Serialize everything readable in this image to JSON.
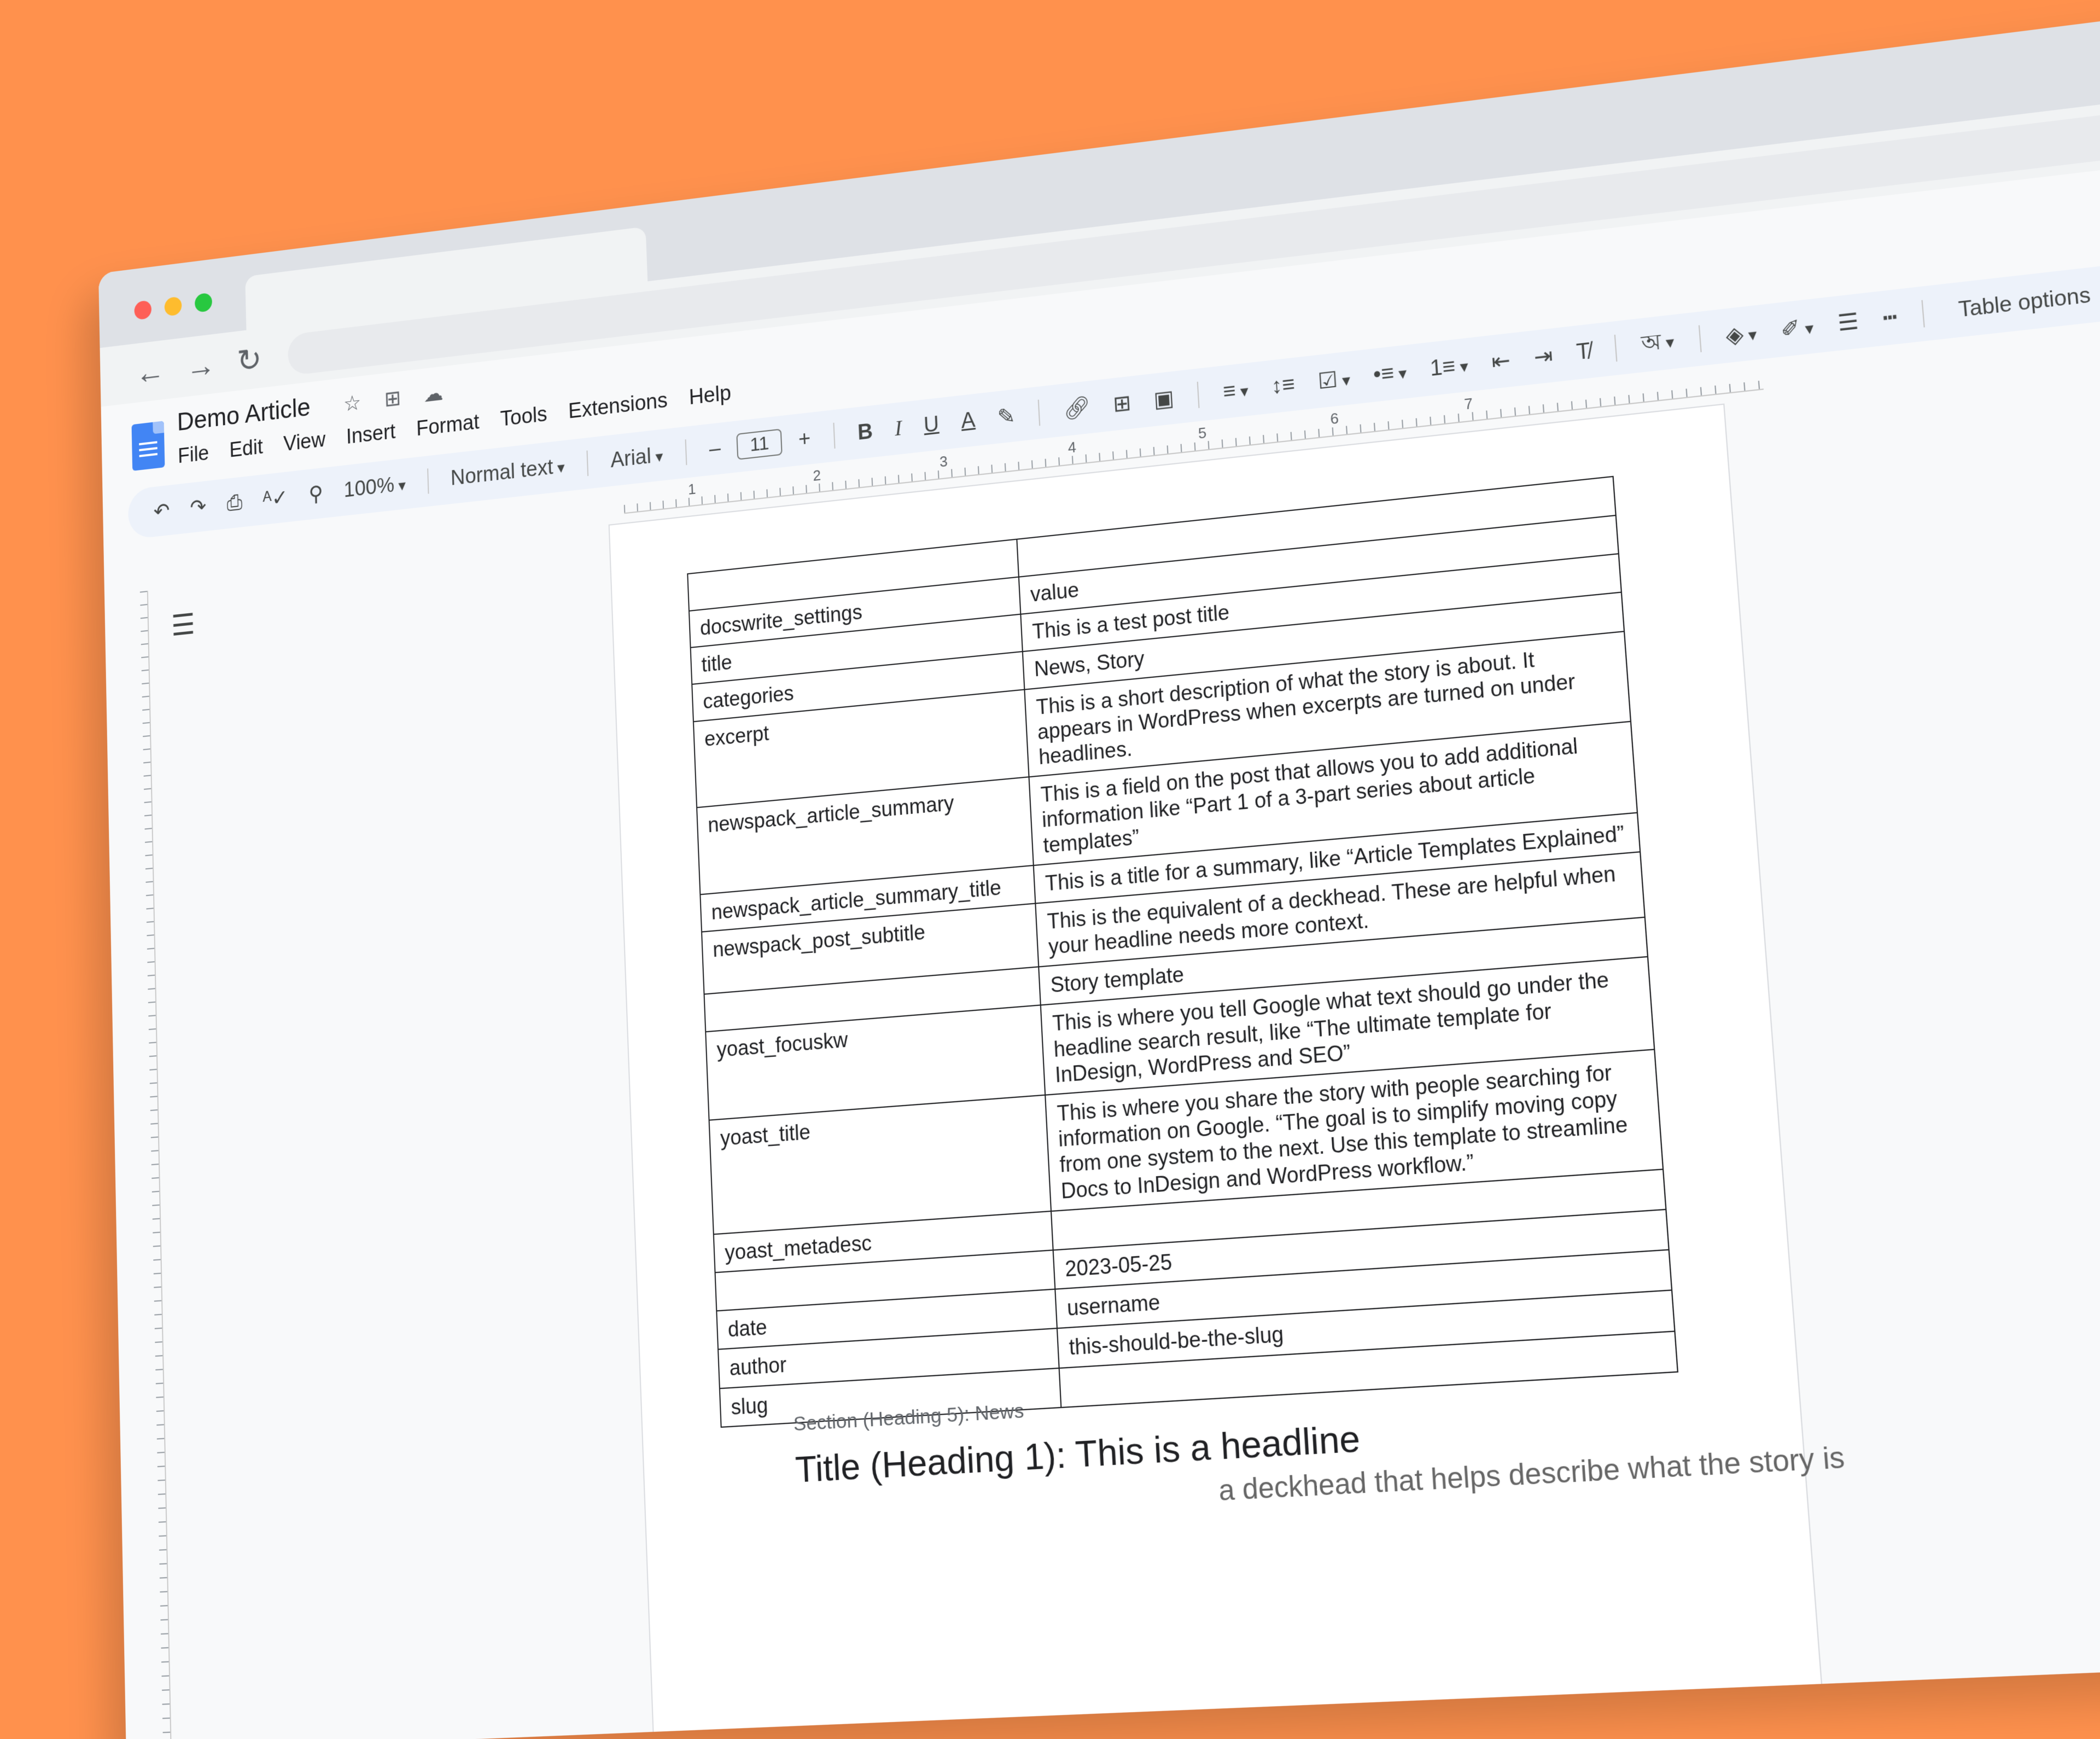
{
  "document": {
    "title": "Demo Article",
    "menu": [
      "File",
      "Edit",
      "View",
      "Insert",
      "Format",
      "Tools",
      "Extensions",
      "Help"
    ]
  },
  "toolbar": {
    "zoom": "100%",
    "style": "Normal text",
    "font": "Arial",
    "font_size": "11",
    "minus": "–",
    "plus": "+",
    "bold": "B",
    "italic": "I",
    "underline": "U",
    "text_color": "A",
    "table_options": "Table options"
  },
  "ruler": {
    "numbers": [
      "1",
      "2",
      "3",
      "4",
      "5",
      "6",
      "7"
    ]
  },
  "table": {
    "rows": [
      [
        "",
        ""
      ],
      [
        "docswrite_settings",
        "value"
      ],
      [
        "title",
        "This is a test post title"
      ],
      [
        "categories",
        "News, Story"
      ],
      [
        "excerpt",
        "This is a short description of what the story is about. It appears in WordPress when excerpts are turned on under headlines."
      ],
      [
        "newspack_article_summary",
        "This is a field on the post that allows you to add additional information like “Part 1 of a 3-part series about article templates”"
      ],
      [
        "newspack_article_summary_title",
        "This is a title for a summary, like “Article Templates Explained”"
      ],
      [
        "newspack_post_subtitle",
        "This is the equivalent of a deckhead. These are helpful when your headline needs more context."
      ],
      [
        "",
        "Story template"
      ],
      [
        "yoast_focuskw",
        "This is where you tell Google what text should go under the headline search result, like “The ultimate template for InDesign, WordPress and SEO”"
      ],
      [
        "yoast_title",
        "This is where you share the story with people searching for information on Google. “The goal is to simplify moving copy from one system to the next. Use this template to streamline Docs to InDesign and WordPress workflow.”"
      ],
      [
        "yoast_metadesc",
        ""
      ],
      [
        "",
        "2023-05-25"
      ],
      [
        "date",
        "username"
      ],
      [
        "author",
        "this-should-be-the-slug"
      ],
      [
        "slug",
        ""
      ]
    ]
  },
  "body": {
    "section_label": "Section (Heading 5): News",
    "heading": "Title (Heading 1): This is a headline",
    "dek": "a deckhead that helps describe what the story is"
  },
  "colors": {
    "background": "#ff914d",
    "docs_blue": "#4285f4"
  },
  "icons": {
    "star": "star-icon",
    "move": "move-to-folder-icon",
    "cloud": "cloud-status-icon",
    "history": "version-history-icon",
    "comments": "comments-icon",
    "meet": "meet-icon"
  }
}
